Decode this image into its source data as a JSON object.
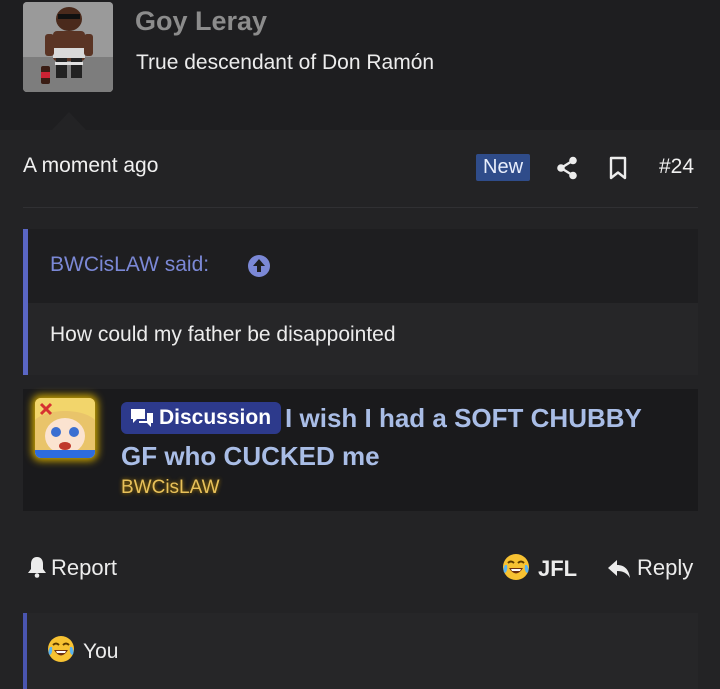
{
  "header": {
    "username": "Goy Leray",
    "user_title": "True descendant of Don Ramón"
  },
  "post": {
    "timestamp": "A moment ago",
    "new_badge": "New",
    "post_number": "#24"
  },
  "quote": {
    "author": "BWCisLAW said:",
    "text": "How could my father be disappointed"
  },
  "embed": {
    "prefix_label": "Discussion",
    "title": "I wish I had a SOFT CHUBBY GF who CUCKED me",
    "author": "BWCisLAW"
  },
  "actions": {
    "report_label": "Report",
    "reaction_label": "JFL",
    "reply_label": "Reply"
  },
  "reactions_bar": {
    "text": "You"
  },
  "colors": {
    "background": "#1e1e20",
    "accent": "#5a66c4",
    "new_badge": "#2f4c8a",
    "discussion_label": "#2d3a8c",
    "embed_title": "#a9bde6",
    "embed_author": "#e8c15a"
  },
  "icons": {
    "share": "share-icon",
    "bookmark": "bookmark-icon",
    "quote_jump": "arrow-up-circle-icon",
    "report": "bell-icon",
    "reaction": "crying-laughing-emoji-icon",
    "reply": "reply-arrow-icon",
    "discussion": "chat-bubbles-icon"
  }
}
